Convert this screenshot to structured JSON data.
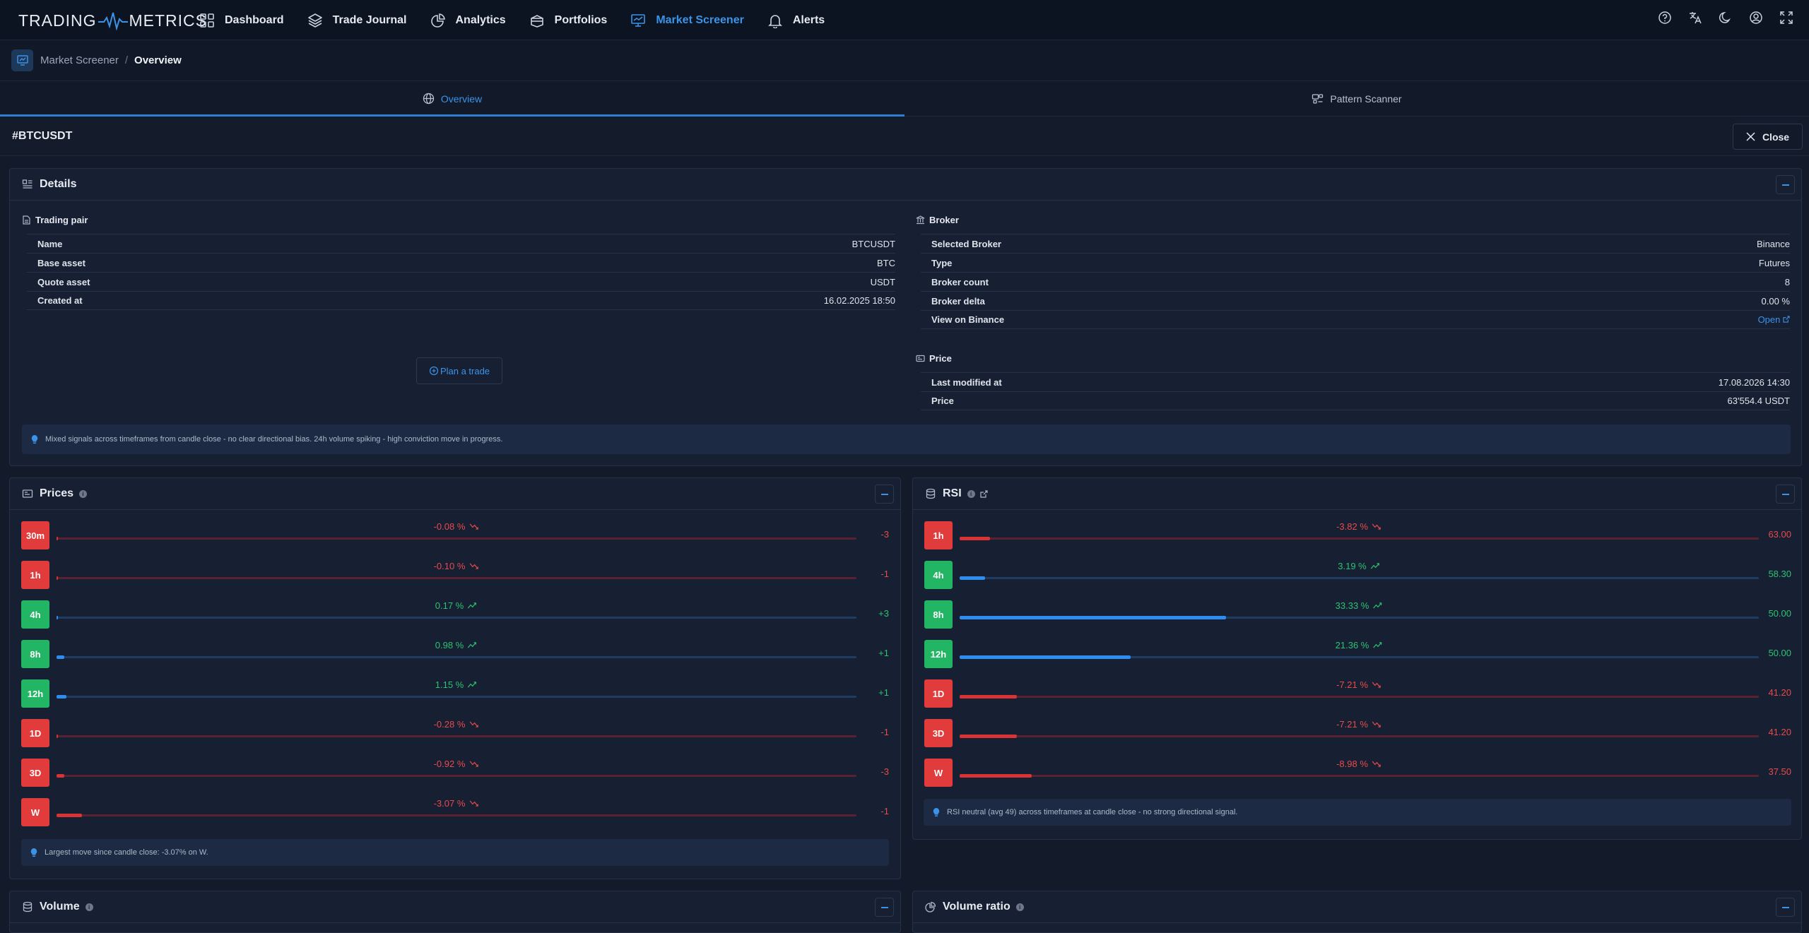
{
  "nav": {
    "logo_left": "TRADING",
    "logo_right": "METRICS",
    "items": [
      {
        "label": "Dashboard",
        "icon": "grid-icon"
      },
      {
        "label": "Trade Journal",
        "icon": "layers-icon"
      },
      {
        "label": "Analytics",
        "icon": "pie-chart-icon"
      },
      {
        "label": "Portfolios",
        "icon": "box-icon"
      },
      {
        "label": "Market Screener",
        "icon": "presentation-icon",
        "active": true
      },
      {
        "label": "Alerts",
        "icon": "bell-icon"
      }
    ],
    "right_icons": [
      "help-icon",
      "translate-icon",
      "moon-icon",
      "user-icon",
      "fullscreen-icon"
    ]
  },
  "breadcrumb": {
    "parent": "Market Screener",
    "separator": "/",
    "current": "Overview"
  },
  "tabs": [
    {
      "label": "Overview",
      "icon": "globe-icon",
      "active": true
    },
    {
      "label": "Pattern Scanner",
      "icon": "pattern-icon",
      "active": false
    }
  ],
  "symbol": "#BTCUSDT",
  "close_label": "Close",
  "details": {
    "title": "Details",
    "trading_pair": {
      "title": "Trading pair",
      "rows": [
        {
          "k": "Name",
          "v": "BTCUSDT"
        },
        {
          "k": "Base asset",
          "v": "BTC"
        },
        {
          "k": "Quote asset",
          "v": "USDT"
        },
        {
          "k": "Created at",
          "v": "16.02.2025 18:50"
        }
      ]
    },
    "broker": {
      "title": "Broker",
      "rows": [
        {
          "k": "Selected Broker",
          "v": "Binance"
        },
        {
          "k": "Type",
          "v": "Futures"
        },
        {
          "k": "Broker count",
          "v": "8"
        },
        {
          "k": "Broker delta",
          "v": "0.00 %"
        },
        {
          "k": "View on Binance",
          "v": "Open"
        }
      ]
    },
    "price": {
      "title": "Price",
      "rows": [
        {
          "k": "Last modified at",
          "v": "17.08.2026 14:30"
        },
        {
          "k": "Price",
          "v": "63'554.4 USDT"
        }
      ]
    },
    "plan_label": "Plan a trade",
    "note": "Mixed signals across timeframes from candle close - no clear directional bias. 24h volume spiking - high conviction move in progress."
  },
  "prices": {
    "title": "Prices",
    "rows": [
      {
        "tf": "30m",
        "dir": "down",
        "pct": "-0.08 %",
        "val": "-3",
        "fill": 0.0
      },
      {
        "tf": "1h",
        "dir": "down",
        "pct": "-0.10 %",
        "val": "-1",
        "fill": 0.0
      },
      {
        "tf": "4h",
        "dir": "up",
        "pct": "0.17 %",
        "val": "+3",
        "fill": 0.0
      },
      {
        "tf": "8h",
        "dir": "up",
        "pct": "0.98 %",
        "val": "+1",
        "fill": 0.01
      },
      {
        "tf": "12h",
        "dir": "up",
        "pct": "1.15 %",
        "val": "+1",
        "fill": 0.012
      },
      {
        "tf": "1D",
        "dir": "down",
        "pct": "-0.28 %",
        "val": "-1",
        "fill": 0.0
      },
      {
        "tf": "3D",
        "dir": "down",
        "pct": "-0.92 %",
        "val": "-3",
        "fill": 0.01
      },
      {
        "tf": "W",
        "dir": "down",
        "pct": "-3.07 %",
        "val": "-1",
        "fill": 0.032
      }
    ],
    "note": "Largest move since candle close: -3.07% on W."
  },
  "rsi": {
    "title": "RSI",
    "rows": [
      {
        "tf": "1h",
        "dir": "down",
        "pct": "-3.82 %",
        "val": "63.00",
        "fill": 0.038
      },
      {
        "tf": "4h",
        "dir": "up",
        "pct": "3.19 %",
        "val": "58.30",
        "fill": 0.032
      },
      {
        "tf": "8h",
        "dir": "up",
        "pct": "33.33 %",
        "val": "50.00",
        "fill": 0.333
      },
      {
        "tf": "12h",
        "dir": "up",
        "pct": "21.36 %",
        "val": "50.00",
        "fill": 0.214
      },
      {
        "tf": "1D",
        "dir": "down",
        "pct": "-7.21 %",
        "val": "41.20",
        "fill": 0.072
      },
      {
        "tf": "3D",
        "dir": "down",
        "pct": "-7.21 %",
        "val": "41.20",
        "fill": 0.072
      },
      {
        "tf": "W",
        "dir": "down",
        "pct": "-8.98 %",
        "val": "37.50",
        "fill": 0.09
      }
    ],
    "note": "RSI neutral (avg 49) across timeframes at candle close - no strong directional signal."
  },
  "volume": {
    "title": "Volume"
  },
  "volume_ratio": {
    "title": "Volume ratio"
  },
  "colors": {
    "accent": "#3b93e8",
    "up": "#22b563",
    "down": "#e23b3b",
    "bg": "#131b2b",
    "panel": "#172033"
  }
}
